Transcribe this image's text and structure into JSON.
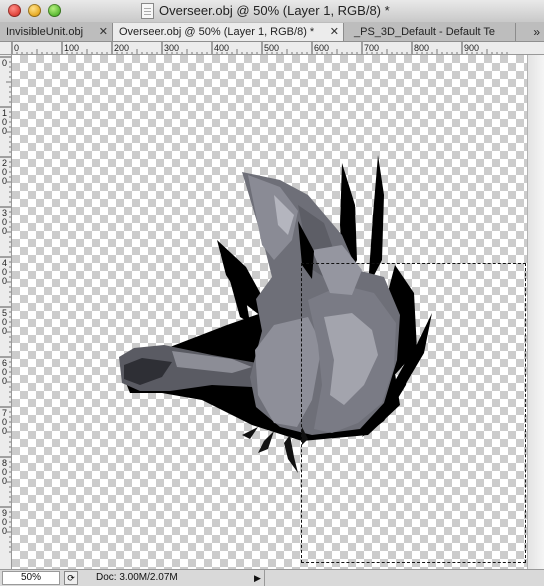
{
  "window": {
    "title": "Overseer.obj @ 50% (Layer 1, RGB/8) *"
  },
  "tabs": [
    {
      "label": "InvisibleUnit.obj",
      "active": false,
      "has_close": true
    },
    {
      "label": "Overseer.obj @ 50% (Layer 1, RGB/8) *",
      "active": true,
      "has_close": true
    },
    {
      "label": "_PS_3D_Default - Default Te",
      "active": false,
      "has_close": false
    }
  ],
  "tab_overflow": "»",
  "rulers": {
    "horizontal_labels": [
      "0",
      "100",
      "200",
      "300",
      "400",
      "500",
      "600",
      "700",
      "800",
      "900"
    ],
    "vertical_labels": [
      "0",
      "100",
      "200",
      "300",
      "400",
      "500",
      "600",
      "700",
      "800",
      "900"
    ]
  },
  "statusbar": {
    "zoom": "50%",
    "doc_info": "Doc: 3.00M/2.07M",
    "menu_arrow": "▶"
  },
  "colors": {
    "checker_light": "#ffffff",
    "checker_dark": "#cccccc",
    "model_body": "#6e6f78",
    "spikes": "#000000"
  }
}
